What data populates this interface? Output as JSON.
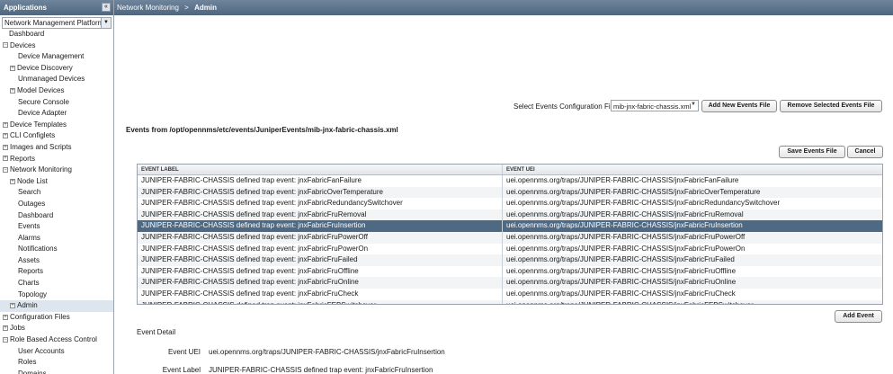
{
  "sidebar": {
    "header": "Applications",
    "collapse_glyph": "«",
    "app_select": "Network Management Platform",
    "tree": [
      {
        "label": "Dashboard",
        "level": 0,
        "leaf": true
      },
      {
        "label": "Devices",
        "level": 0,
        "exp": "−"
      },
      {
        "label": "Device Management",
        "level": 1,
        "leaf": true
      },
      {
        "label": "Device Discovery",
        "level": 1,
        "exp": "+"
      },
      {
        "label": "Unmanaged Devices",
        "level": 1,
        "leaf": true
      },
      {
        "label": "Model Devices",
        "level": 1,
        "exp": "+"
      },
      {
        "label": "Secure Console",
        "level": 1,
        "leaf": true
      },
      {
        "label": "Device Adapter",
        "level": 1,
        "leaf": true
      },
      {
        "label": "Device Templates",
        "level": 0,
        "exp": "+"
      },
      {
        "label": "CLI Configlets",
        "level": 0,
        "exp": "+"
      },
      {
        "label": "Images and Scripts",
        "level": 0,
        "exp": "+"
      },
      {
        "label": "Reports",
        "level": 0,
        "exp": "+"
      },
      {
        "label": "Network Monitoring",
        "level": 0,
        "exp": "−"
      },
      {
        "label": "Node List",
        "level": 1,
        "exp": "+"
      },
      {
        "label": "Search",
        "level": 1,
        "leaf": true
      },
      {
        "label": "Outages",
        "level": 1,
        "leaf": true
      },
      {
        "label": "Dashboard",
        "level": 1,
        "leaf": true
      },
      {
        "label": "Events",
        "level": 1,
        "leaf": true
      },
      {
        "label": "Alarms",
        "level": 1,
        "leaf": true
      },
      {
        "label": "Notifications",
        "level": 1,
        "leaf": true
      },
      {
        "label": "Assets",
        "level": 1,
        "leaf": true
      },
      {
        "label": "Reports",
        "level": 1,
        "leaf": true
      },
      {
        "label": "Charts",
        "level": 1,
        "leaf": true
      },
      {
        "label": "Topology",
        "level": 1,
        "leaf": true
      },
      {
        "label": "Admin",
        "level": 1,
        "exp": "+",
        "selected": true
      },
      {
        "label": "Configuration Files",
        "level": 0,
        "exp": "+"
      },
      {
        "label": "Jobs",
        "level": 0,
        "exp": "+"
      },
      {
        "label": "Role Based Access Control",
        "level": 0,
        "exp": "−"
      },
      {
        "label": "User Accounts",
        "level": 1,
        "leaf": true
      },
      {
        "label": "Roles",
        "level": 1,
        "leaf": true
      },
      {
        "label": "Domains",
        "level": 1,
        "leaf": true
      }
    ]
  },
  "breadcrumb": {
    "parent": "Network Monitoring",
    "separator": ">",
    "current": "Admin"
  },
  "config": {
    "select_label": "Select Events Configuration File",
    "selected_file": "mib-jnx-fabric-chassis.xml",
    "add_label": "Add New Events File",
    "remove_label": "Remove Selected Events File"
  },
  "events_from": "Events from /opt/opennms/etc/events/JuniperEvents/mib-jnx-fabric-chassis.xml",
  "actions": {
    "save_label": "Save Events File",
    "cancel_label": "Cancel",
    "add_event_label": "Add Event"
  },
  "grid": {
    "headers": [
      "EVENT LABEL",
      "EVENT UEI"
    ],
    "rows": [
      [
        "JUNIPER-FABRIC-CHASSIS defined trap event: jnxFabricFanFailure",
        "uei.opennms.org/traps/JUNIPER-FABRIC-CHASSIS/jnxFabricFanFailure"
      ],
      [
        "JUNIPER-FABRIC-CHASSIS defined trap event: jnxFabricOverTemperature",
        "uei.opennms.org/traps/JUNIPER-FABRIC-CHASSIS/jnxFabricOverTemperature"
      ],
      [
        "JUNIPER-FABRIC-CHASSIS defined trap event: jnxFabricRedundancySwitchover",
        "uei.opennms.org/traps/JUNIPER-FABRIC-CHASSIS/jnxFabricRedundancySwitchover"
      ],
      [
        "JUNIPER-FABRIC-CHASSIS defined trap event: jnxFabricFruRemoval",
        "uei.opennms.org/traps/JUNIPER-FABRIC-CHASSIS/jnxFabricFruRemoval"
      ],
      [
        "JUNIPER-FABRIC-CHASSIS defined trap event: jnxFabricFruInsertion",
        "uei.opennms.org/traps/JUNIPER-FABRIC-CHASSIS/jnxFabricFruInsertion"
      ],
      [
        "JUNIPER-FABRIC-CHASSIS defined trap event: jnxFabricFruPowerOff",
        "uei.opennms.org/traps/JUNIPER-FABRIC-CHASSIS/jnxFabricFruPowerOff"
      ],
      [
        "JUNIPER-FABRIC-CHASSIS defined trap event: jnxFabricFruPowerOn",
        "uei.opennms.org/traps/JUNIPER-FABRIC-CHASSIS/jnxFabricFruPowerOn"
      ],
      [
        "JUNIPER-FABRIC-CHASSIS defined trap event: jnxFabricFruFailed",
        "uei.opennms.org/traps/JUNIPER-FABRIC-CHASSIS/jnxFabricFruFailed"
      ],
      [
        "JUNIPER-FABRIC-CHASSIS defined trap event: jnxFabricFruOffline",
        "uei.opennms.org/traps/JUNIPER-FABRIC-CHASSIS/jnxFabricFruOffline"
      ],
      [
        "JUNIPER-FABRIC-CHASSIS defined trap event: jnxFabricFruOnline",
        "uei.opennms.org/traps/JUNIPER-FABRIC-CHASSIS/jnxFabricFruOnline"
      ],
      [
        "JUNIPER-FABRIC-CHASSIS defined trap event: jnxFabricFruCheck",
        "uei.opennms.org/traps/JUNIPER-FABRIC-CHASSIS/jnxFabricFruCheck"
      ],
      [
        "JUNIPER-FABRIC-CHASSIS defined trap event: jnxFabricFEBSwitchover",
        "uei.opennms.org/traps/JUNIPER-FABRIC-CHASSIS/jnxFabricFEBSwitchover"
      ]
    ],
    "selected_index": 4
  },
  "detail": {
    "title": "Event Detail",
    "uei_label": "Event UEI",
    "uei_value": "uei.opennms.org/traps/JUNIPER-FABRIC-CHASSIS/jnxFabricFruInsertion",
    "label_label": "Event Label",
    "label_value": "JUNIPER-FABRIC-CHASSIS defined trap event: jnxFabricFruInsertion"
  }
}
